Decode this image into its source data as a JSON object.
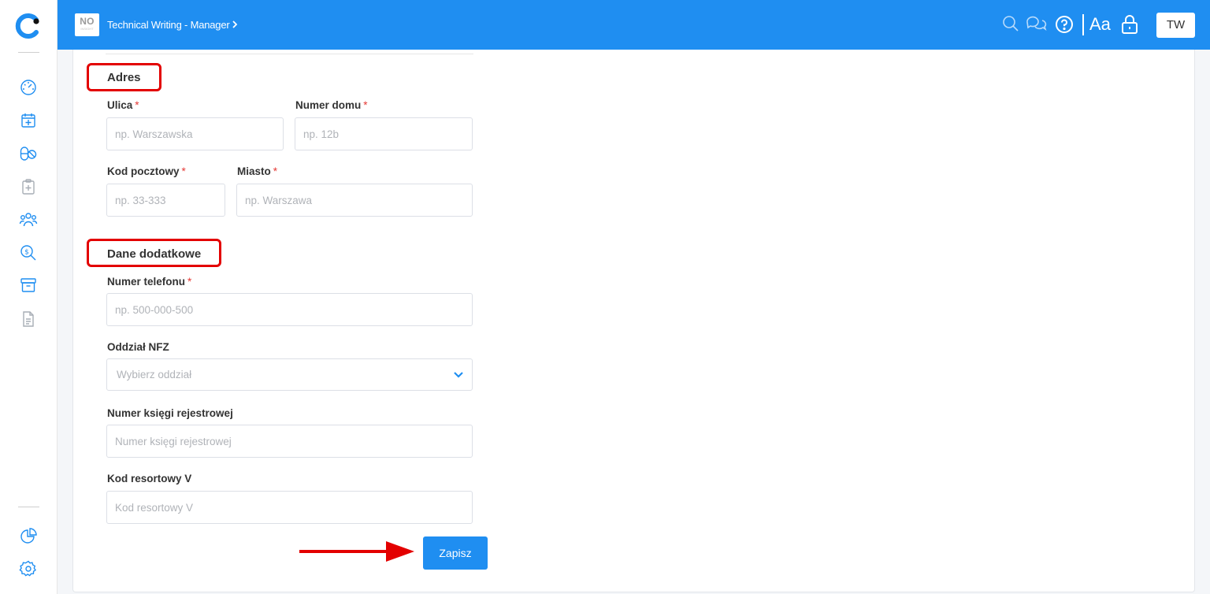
{
  "header": {
    "workspace_badge": "NO",
    "workspace_badge_sub": "INSIGHT",
    "breadcrumb": "Technical Writing - Manager",
    "font_size_label": "Aa",
    "user_initials": "TW"
  },
  "form": {
    "address_section": {
      "title": "Adres",
      "street": {
        "label": "Ulica",
        "required_mark": "*",
        "placeholder": "np. Warszawska"
      },
      "house_number": {
        "label": "Numer domu",
        "required_mark": "*",
        "placeholder": "np. 12b"
      },
      "postal_code": {
        "label": "Kod pocztowy",
        "required_mark": "*",
        "placeholder": "np. 33-333"
      },
      "city": {
        "label": "Miasto",
        "required_mark": "*",
        "placeholder": "np. Warszawa"
      }
    },
    "additional_section": {
      "title": "Dane dodatkowe",
      "phone": {
        "label": "Numer telefonu",
        "required_mark": "*",
        "placeholder": "np. 500-000-500"
      },
      "nfz_branch": {
        "label": "Oddział NFZ",
        "placeholder": "Wybierz oddział"
      },
      "register_number": {
        "label": "Numer księgi rejestrowej",
        "placeholder": "Numer księgi rejestrowej"
      },
      "department_code": {
        "label": "Kod resortowy V",
        "placeholder": "Kod resortowy V"
      }
    },
    "save_label": "Zapisz"
  },
  "colors": {
    "primary": "#1f8ef1",
    "highlight": "#e30000",
    "required": "#e53935"
  },
  "icons": {
    "sidebar": [
      "dashboard-icon",
      "calendar-add-icon",
      "pills-icon",
      "clipboard-add-icon",
      "patients-icon",
      "billing-search-icon",
      "archive-icon",
      "document-icon",
      "reports-pie-icon",
      "settings-gear-icon"
    ],
    "header": [
      "search-icon",
      "chat-icon",
      "help-icon",
      "font-size-icon",
      "lock-icon"
    ]
  }
}
